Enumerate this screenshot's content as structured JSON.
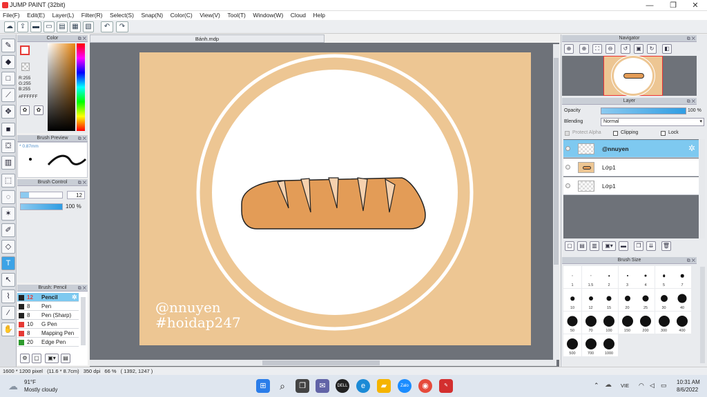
{
  "app": {
    "title": "JUMP PAINT (32bit)"
  },
  "window_controls": {
    "minimize": "—",
    "restore": "❐",
    "close": "✕"
  },
  "menu": [
    "File(F)",
    "Edit(E)",
    "Layer(L)",
    "Filter(R)",
    "Select(S)",
    "Snap(N)",
    "Color(C)",
    "View(V)",
    "Tool(T)",
    "Window(W)",
    "Cloud",
    "Help"
  ],
  "document": {
    "tab_title": "Bánh.mdp"
  },
  "color_panel": {
    "title": "Color",
    "r": "R:255",
    "g": "G:255",
    "b": "B:255",
    "hex": "#FFFFFF",
    "main_color": "#ffffff",
    "sub_color": "#e53935"
  },
  "brush_preview": {
    "title": "Brush Preview",
    "size_label": "* 0.87mm"
  },
  "brush_control": {
    "title": "Brush Control",
    "size_value": "12",
    "opacity_value": "100 %"
  },
  "brush_list": {
    "title": "Brush: Pencil",
    "items": [
      {
        "size": "12",
        "name": "Pencil",
        "color": "#222222"
      },
      {
        "size": "8",
        "name": "Pen",
        "color": "#222222"
      },
      {
        "size": "8",
        "name": "Pen (Sharp)",
        "color": "#222222"
      },
      {
        "size": "10",
        "name": "G Pen",
        "color": "#e53935"
      },
      {
        "size": "8",
        "name": "Mapping Pen",
        "color": "#e53935"
      },
      {
        "size": "20",
        "name": "Edge Pen",
        "color": "#2e9b2e"
      }
    ]
  },
  "navigator": {
    "title": "Navigator"
  },
  "layer_panel": {
    "title": "Layer",
    "opacity_label": "Opacity",
    "opacity_value": "100 %",
    "blending_label": "Blending",
    "blending_value": "Normal",
    "protect_alpha": "Protect Alpha",
    "clipping": "Clipping",
    "lock": "Lock",
    "layers": [
      {
        "name": "@nnuyen",
        "selected": true
      },
      {
        "name": "Lớp1",
        "selected": false
      },
      {
        "name": "Lớp1",
        "selected": false
      }
    ]
  },
  "brush_size": {
    "title": "Brush Size",
    "sizes": [
      "1",
      "1.5",
      "2",
      "3",
      "4",
      "5",
      "7",
      "10",
      "12",
      "15",
      "20",
      "25",
      "30",
      "40",
      "50",
      "70",
      "100",
      "150",
      "200",
      "300",
      "400",
      "500",
      "700",
      "1000"
    ]
  },
  "artwork": {
    "watermark_line1": "@nnuyen",
    "watermark_line2": "#hoidap247",
    "background_color": "#edc693",
    "bread_color": "#e39c57",
    "cut_color": "#f6d1ae"
  },
  "status": {
    "size": "1600 * 1200 pixel",
    "size_cm": "(11.6 * 8.7cm)",
    "dpi": "350 dpi",
    "zoom": "66 %",
    "coords": "( 1392, 1247 )"
  },
  "taskbar": {
    "weather_temp": "91°F",
    "weather_text": "Mostly cloudy",
    "language": "VIE",
    "time": "10:31 AM",
    "date": "8/6/2022"
  }
}
